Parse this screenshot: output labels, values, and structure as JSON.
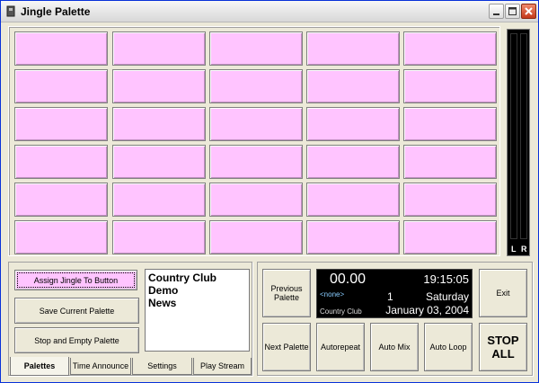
{
  "window": {
    "title": "Jingle Palette",
    "icon": "jingle-app-icon"
  },
  "jingle_grid": {
    "rows": 6,
    "cols": 5,
    "button_color": "#ffc4ff"
  },
  "vu_meter": {
    "left_label": "L",
    "right_label": "R"
  },
  "left_panel": {
    "assign_label": "Assign Jingle To Button",
    "save_label": "Save Current Palette",
    "stop_empty_label": "Stop and Empty Palette",
    "palettes": [
      "Country Club",
      "Demo",
      "News"
    ],
    "tabs": [
      {
        "label": "Palettes",
        "active": true
      },
      {
        "label": "Time Announce",
        "active": false
      },
      {
        "label": "Settings",
        "active": false
      },
      {
        "label": "Play Stream",
        "active": false
      }
    ]
  },
  "right_panel": {
    "previous_label": "Previous Palette",
    "next_label": "Next Palette",
    "exit_label": "Exit",
    "autorepeat_label": "Autorepeat",
    "automix_label": "Auto Mix",
    "autoloop_label": "Auto Loop",
    "stop_all_label": "STOP ALL",
    "display": {
      "elapsed": "00.00",
      "clock": "19:15:05",
      "current": "<none>",
      "count": "1",
      "day": "Saturday",
      "palette": "Country Club",
      "date": "January 03, 2004"
    }
  }
}
